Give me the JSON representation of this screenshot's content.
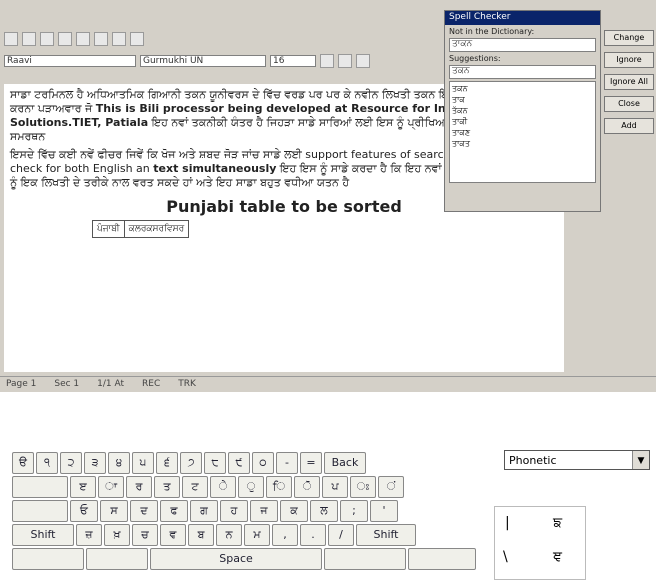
{
  "editor": {
    "toolbar_font": "Raavi",
    "toolbar_font2": "Gurmukhi UN",
    "toolbar_size": "16",
    "paragraph1_prefix": "ਸਾਡਾ ਟਰਮਿਨਲ ਹੈ ਅਧਿਆਤਮਿਕ ਗਿਆਨੀ ਤਕਨ ਯੂਨੀਵਰਸ ਦੇ ਵਿੱਚ ਵਰਡ ਪਰ ਪਰ ਕੇ ਨਵੀਨ ਲਿਖਤੀ ਤਕਨ ਇਹ ਸਾਡੇ ਦੀ ਆਪਣੀ ਤਾਂ ਕਰਨਾ ਪੜਾਅਵਾਰ ਜੋ",
    "paragraph1_bold": "This is Bili processor being developed at Resource for Indian Language T Solutions.TIET, Patiala",
    "paragraph1_suffix": "ਇਹ ਨਵਾਂ ਤਕਨੀਕੀ ਯੰਤਰ ਹੈ ਜਿਹੜਾ ਸਾਡੇ ਸਾਰਿਆਂ ਲਈ ਇਸ ਨੂੰ ਪ੍ਰੀਖਿਆ ਵਿੱਚ ਲਿਖਤੀ ਅਤੇ ਸਮਰਥਨ",
    "paragraph2_prefix": "ਇਸਦੇ ਵਿੱਚ ਕਈ ਨਵੇਂ ਫੀਚਰ ਜਿਵੇਂ ਕਿ ਖੋਜ ਅਤੇ ਸ਼ਬਦ ਜੋੜ ਜਾਂਚ ਸਾਡੇ ਲਈ support features of searching,sorting,spell check for both English an",
    "paragraph2_bold": "text simultaneously",
    "paragraph2_suffix": "ਇਹ ਇਸ ਨੂੰ ਸਾਡੇ ਕਰਦਾ ਹੈ ਕਿ ਇਹ ਨਵਾਂ ਹੈ ਅਤੇ ਸਾਰਿਆਂ ਲਈ ਇਸ ਨੂੰ ਇਕ ਲਿਖਤੀ ਦੇ ਤਰੀਕੇ ਨਾਲ ਵਰਤ ਸਕਦੇ ਹਾਂ ਅਤੇ ਇਹ ਸਾਡਾ ਬਹੁਤ ਵਧੀਆ ਯਤਨ ਹੈ",
    "heading": "Punjabi table to be sorted",
    "table_cell1": "ਪੰਜਾਬੀ",
    "table_cell2": "ਕਲਰਕਸਰਵਿਸਰ",
    "status": [
      "Page 1",
      "Sec 1",
      "1/1 At",
      "REC",
      "TRK"
    ]
  },
  "spell_dialog": {
    "title": "Spell Checker",
    "not_in_dict_label": "Not in the Dictionary:",
    "word": "ਤਾਕਨ",
    "suggestions_label": "Suggestions:",
    "suggestion_selected": "ਤਕਨ",
    "suggestions": [
      "ਤਕਨ",
      "ਤਾਕ",
      "ਤੱਕਨ",
      "ਤਾਕੀ",
      "ਤਾਕਣ",
      "ਤਾਕਤ"
    ],
    "buttons": [
      "Change",
      "Ignore",
      "Ignore All",
      "Close",
      "Add"
    ]
  },
  "keyboard": {
    "layout": "Phonetic",
    "back_label": "Back",
    "shift_label": "Shift",
    "space_label": "Space",
    "row1": [
      "ੳ",
      "੧",
      "੨",
      "੩",
      "੪",
      "੫",
      "੬",
      "੭",
      "੮",
      "੯",
      "੦",
      "-",
      "="
    ],
    "row2": [
      "ੲ",
      "ਾ",
      "ਰ",
      "ਤ",
      "ਟ",
      "ੇ",
      "ੁ",
      "ਿ",
      "ੋ",
      "ਪ",
      "ਃ",
      "ਂ"
    ],
    "row3": [
      "ਓ",
      "ਸ",
      "ਦ",
      "ਫ",
      "ਗ",
      "ਹ",
      "ਜ",
      "ਕ",
      "ਲ",
      ";",
      "'"
    ],
    "row4": [
      "ਜ਼",
      "ਖ਼",
      "ਚ",
      "ਵ",
      "ਬ",
      "ਨ",
      "ਮ",
      ",",
      ".",
      "/"
    ],
    "popup_items": [
      "|",
      "ਙ",
      "\\",
      "ਞ"
    ]
  }
}
